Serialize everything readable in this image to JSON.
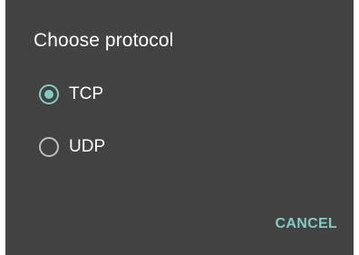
{
  "dialog": {
    "title": "Choose protocol",
    "options": [
      {
        "label": "TCP",
        "selected": true
      },
      {
        "label": "UDP",
        "selected": false
      }
    ],
    "cancel_label": "CANCEL"
  },
  "colors": {
    "dialog_background": "#424242",
    "accent": "#80cbc4",
    "text": "#ffffff",
    "radio_unchecked": "#bdbdbd"
  }
}
